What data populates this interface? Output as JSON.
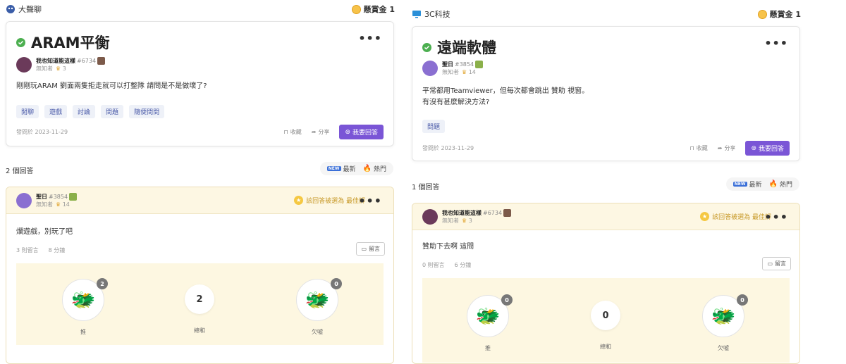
{
  "left": {
    "category": "大聲聊",
    "bounty_label": "懸賞金 1",
    "question": {
      "title": "ARAM平衡",
      "user_name": "我也知道能這樣",
      "user_id": "#6734",
      "user_rank": "無知者",
      "user_level": "3",
      "body": "剛剛玩ARAM 劉面兩隻拒走就可以打整隊 請問是不是做壞了?",
      "tags": [
        "閒聊",
        "遊戲",
        "討論",
        "問題",
        "隨便問問"
      ],
      "posted": "發問於 2023-11-29",
      "save_label": "收藏",
      "share_label": "分享",
      "answer_label": "我要回答"
    },
    "answer_count": "2 個回答",
    "sort_new": "最新",
    "sort_hot": "熱門",
    "answer": {
      "user_name": "聖日",
      "user_id": "#3854",
      "user_rank": "無知者",
      "user_level": "14",
      "best_label": "該回答被選為 最佳解",
      "body": "爛遊戲，別玩了吧",
      "replies": "3 則留言",
      "minutes": "8 分鐘",
      "comment_label": "留言",
      "vote_up_count": "2",
      "vote_total": "2",
      "vote_down_count": "0",
      "vote_up_label": "推",
      "vote_total_label": "總和",
      "vote_down_label": "欠噓"
    }
  },
  "right": {
    "category": "3C科技",
    "bounty_label": "懸賞金 1",
    "question": {
      "title": "遠端軟體",
      "user_name": "聖日",
      "user_id": "#3854",
      "user_rank": "無知者",
      "user_level": "14",
      "body_line1": "平常都用Teamviewer，但每次都會跳出 贊助 視窗。",
      "body_line2": "有沒有甚麼解決方法?",
      "tags": [
        "問題"
      ],
      "posted": "發問於 2023-11-29",
      "save_label": "收藏",
      "share_label": "分享",
      "answer_label": "我要回答"
    },
    "answer_count": "1 個回答",
    "sort_new": "最新",
    "sort_hot": "熱門",
    "answer": {
      "user_name": "我也知道能這樣",
      "user_id": "#6734",
      "user_rank": "無知者",
      "user_level": "3",
      "best_label": "該回答被選為 最佳解",
      "body": "贊助下去啊 這問",
      "replies": "0 則留言",
      "minutes": "6 分鐘",
      "comment_label": "留言",
      "vote_up_count": "0",
      "vote_total": "0",
      "vote_down_count": "0",
      "vote_up_label": "推",
      "vote_total_label": "總和",
      "vote_down_label": "欠噓"
    }
  }
}
